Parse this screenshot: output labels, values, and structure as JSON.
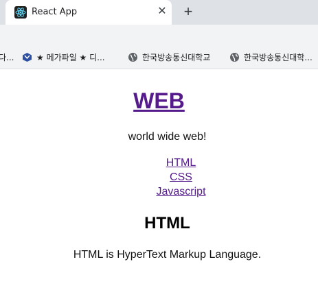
{
  "browser": {
    "tab_title": "React App",
    "new_tab_symbol": "+",
    "close_symbol": "✕"
  },
  "bookmarks": [
    {
      "label": "다..."
    },
    {
      "label": "★ 메가파일 ★ 디..."
    },
    {
      "label": "한국방송통신대학교"
    },
    {
      "label": "한국방송통신대학..."
    }
  ],
  "page": {
    "heading": "WEB",
    "tagline": "world wide web!",
    "nav": [
      "HTML",
      "CSS",
      "Javascript"
    ],
    "section_title": "HTML",
    "section_body": "HTML is HyperText Markup Language."
  },
  "colors": {
    "link_visited": "#551a8b",
    "tabstrip": "#dee1e6",
    "toolbar": "#f1f3f4"
  }
}
